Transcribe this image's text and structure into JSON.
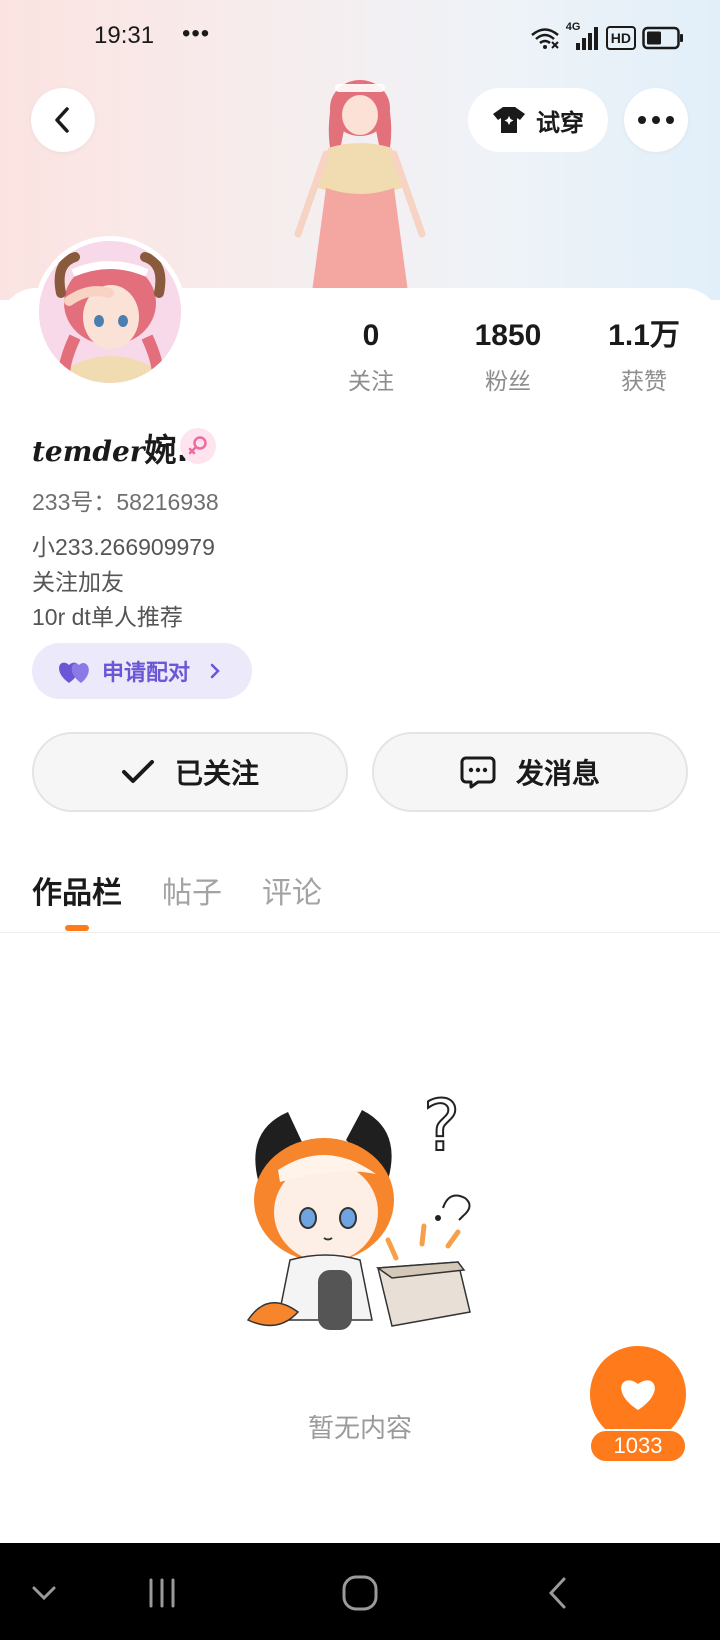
{
  "status_bar": {
    "time": "19:31",
    "dots": "•••",
    "network": "4G",
    "hd": "HD"
  },
  "header": {
    "try_on_label": "试穿",
    "background_colors": [
      "#fbe3e1",
      "#e2eff9"
    ]
  },
  "stats": [
    {
      "value": "0",
      "label": "关注"
    },
    {
      "value": "1850",
      "label": "粉丝"
    },
    {
      "value": "1.1万",
      "label": "获赞"
    }
  ],
  "profile": {
    "username_script": "temder",
    "username_tail": "婉.",
    "gender_icon": "female-icon",
    "id_text": "233号：58216938",
    "bio_lines": [
      "小233.266909979",
      "关注加友",
      "10r dt单人推荐"
    ],
    "pair_label": "申请配对"
  },
  "actions": {
    "follow_label": "已关注",
    "message_label": "发消息"
  },
  "tabs": [
    {
      "label": "作品栏",
      "active": true
    },
    {
      "label": "帖子",
      "active": false
    },
    {
      "label": "评论",
      "active": false
    }
  ],
  "empty_state": {
    "text": "暂无内容"
  },
  "like": {
    "count": "1033",
    "accent": "#ff7a1a"
  },
  "theme": {
    "pair_chip_color": "#6a57d6",
    "tab_indicator": "#ff7a1a"
  }
}
